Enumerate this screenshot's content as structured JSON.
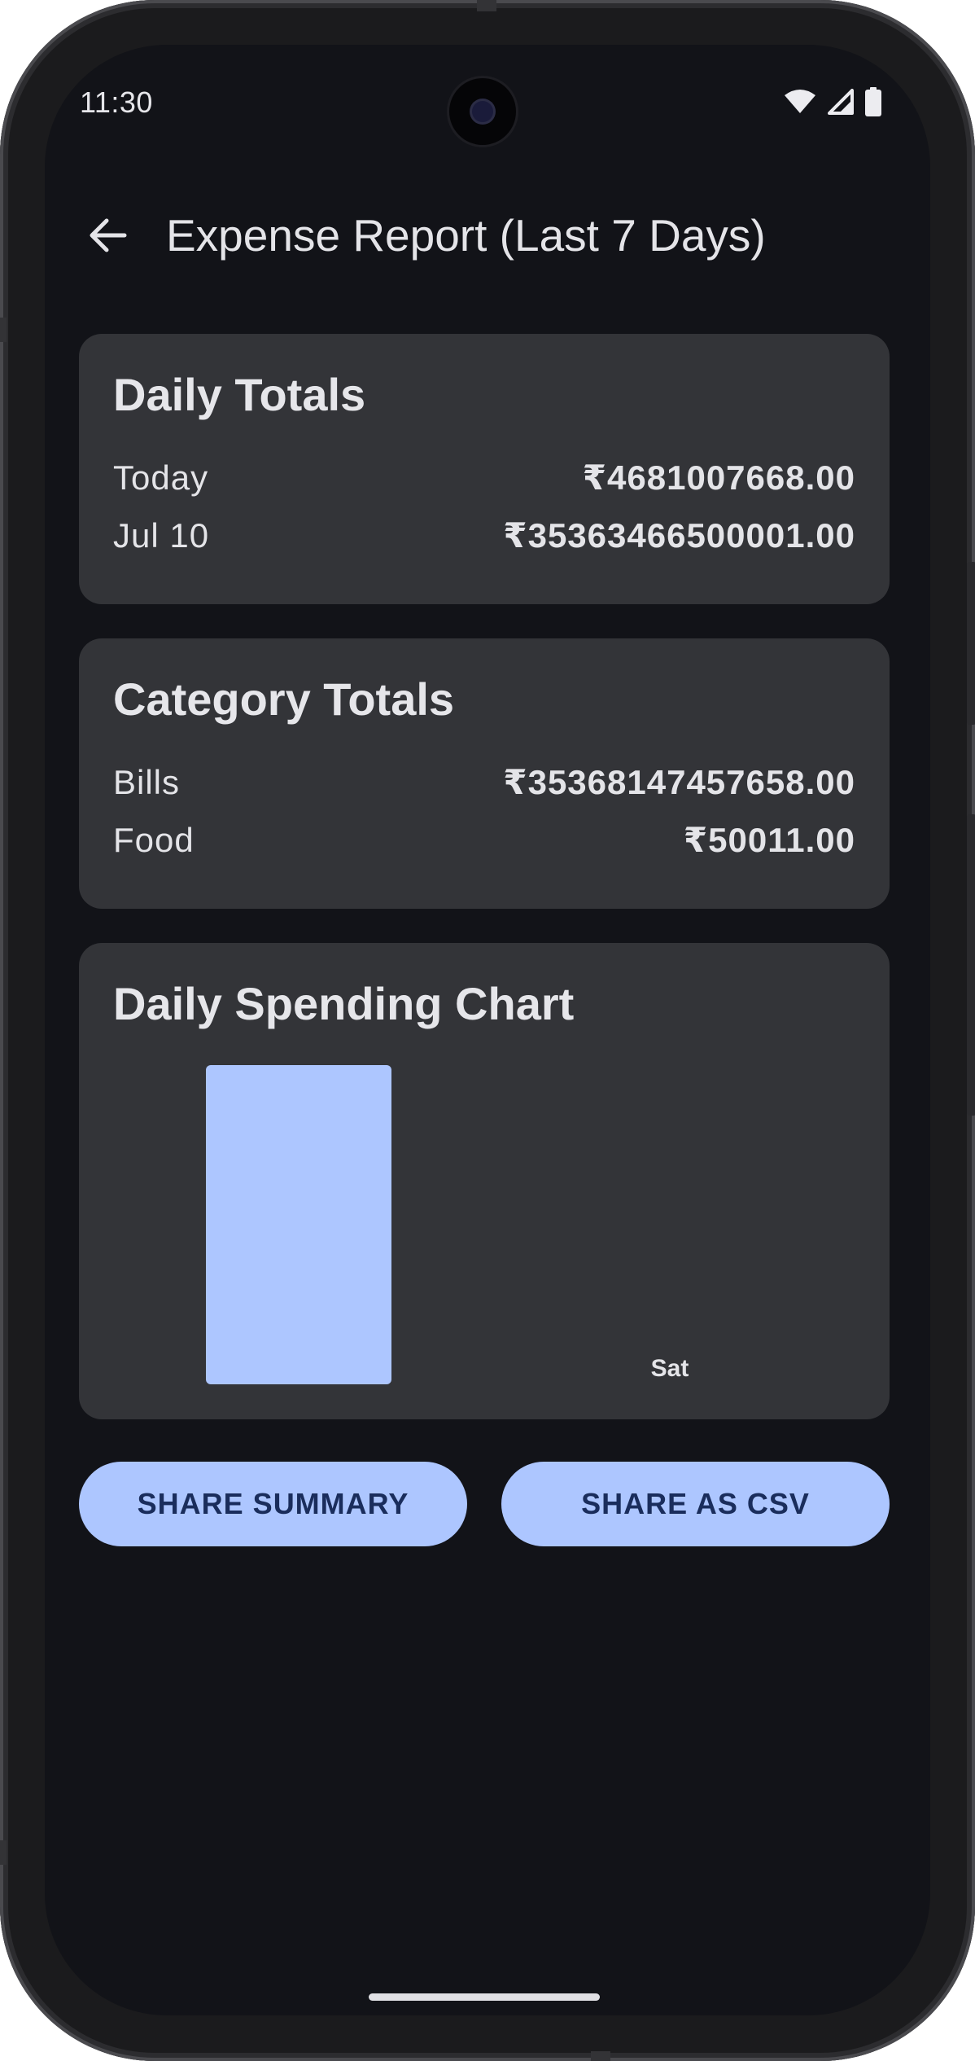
{
  "status_bar": {
    "time": "11:30",
    "icons": [
      "wifi-icon",
      "cellular-signal-icon",
      "battery-icon"
    ]
  },
  "app_bar": {
    "back_icon": "arrow-back-icon",
    "title": "Expense Report (Last 7 Days)"
  },
  "daily_totals": {
    "title": "Daily Totals",
    "rows": [
      {
        "label": "Today",
        "amount": "₹4681007668.00"
      },
      {
        "label": "Jul 10",
        "amount": "₹35363466500001.00"
      }
    ]
  },
  "category_totals": {
    "title": "Category Totals",
    "rows": [
      {
        "label": "Bills",
        "amount": "₹35368147457658.00"
      },
      {
        "label": "Food",
        "amount": "₹50011.00"
      }
    ]
  },
  "chart_card": {
    "title": "Daily Spending Chart"
  },
  "chart_data": {
    "type": "bar",
    "title": "Daily Spending Chart",
    "categories": [
      "",
      "Sat"
    ],
    "values": [
      35363466500001.0,
      4681007668.0
    ],
    "bar_color": "#adc6ff",
    "xlabel": "",
    "ylabel": "",
    "grid": false
  },
  "actions": {
    "share_summary": "SHARE SUMMARY",
    "share_csv": "SHARE AS CSV"
  },
  "colors": {
    "background": "#121318",
    "card": "#333438",
    "accent": "#adc6ff",
    "accent_text": "#1a2d5c"
  }
}
